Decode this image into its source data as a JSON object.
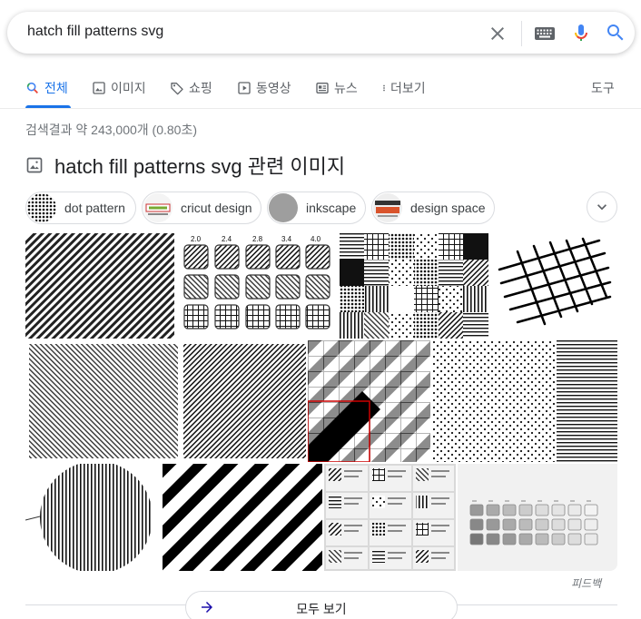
{
  "search": {
    "query": "hatch fill patterns svg"
  },
  "tabs": [
    {
      "label": "전체",
      "icon": "search-icon",
      "active": true
    },
    {
      "label": "이미지",
      "icon": "image-icon"
    },
    {
      "label": "쇼핑",
      "icon": "tag-icon"
    },
    {
      "label": "동영상",
      "icon": "play-icon"
    },
    {
      "label": "뉴스",
      "icon": "news-icon"
    },
    {
      "label": "더보기",
      "icon": "more-vert-icon"
    }
  ],
  "tools_label": "도구",
  "result_stats": "검색결과 약 243,000개 (0.80초)",
  "images_section": {
    "title": "hatch fill patterns svg 관련 이미지",
    "chips": [
      {
        "label": "dot pattern"
      },
      {
        "label": "cricut design"
      },
      {
        "label": "inkscape"
      },
      {
        "label": "design space"
      }
    ],
    "thumb_labels": [
      "2.0",
      "2.4",
      "2.8",
      "3.4",
      "4.0"
    ]
  },
  "feedback_label": "피드백",
  "view_all_label": "모두 보기",
  "colors": {
    "accent": "#1a73e8",
    "mic_red": "#ea4335",
    "mic_yellow": "#fbbc04",
    "mic_green": "#34a853"
  }
}
